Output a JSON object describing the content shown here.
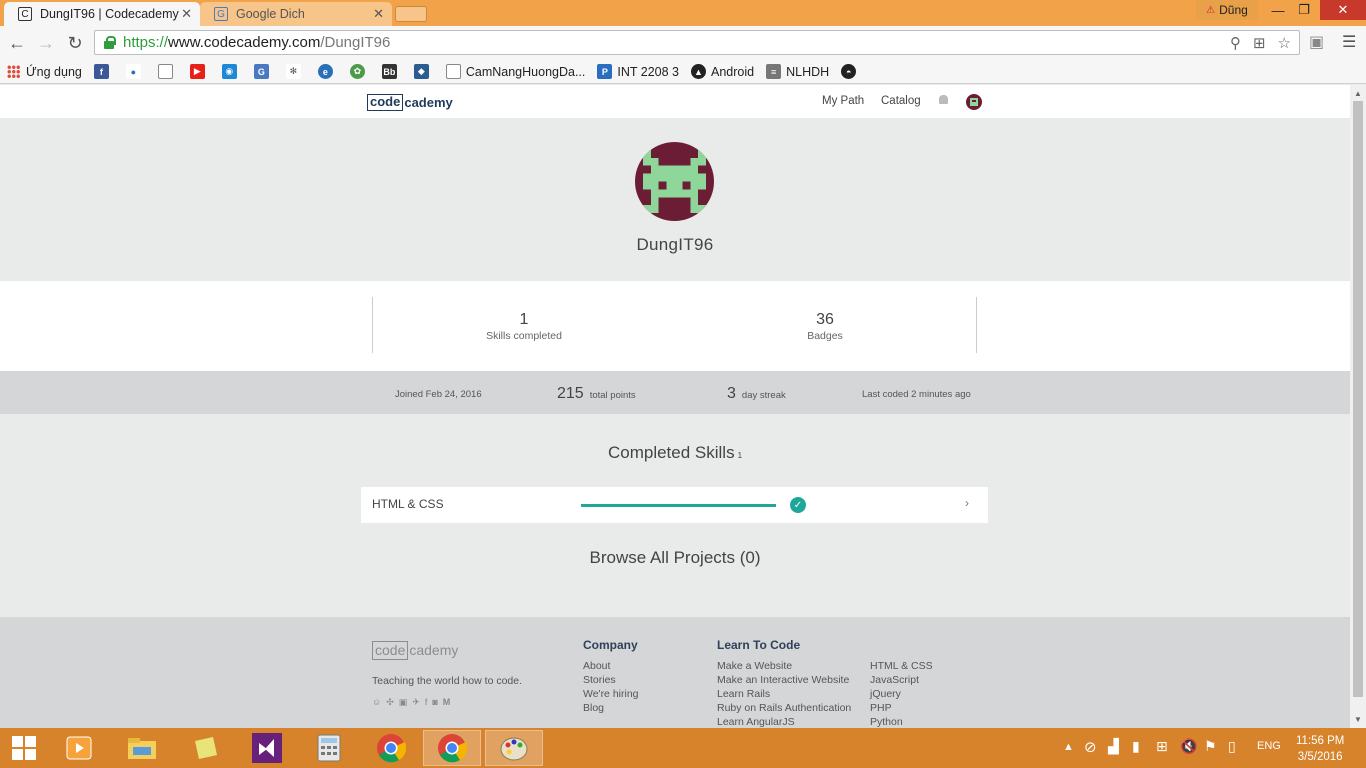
{
  "browser": {
    "tabs": [
      {
        "title": "DungIT96 | Codecademy",
        "active": true
      },
      {
        "title": "Google Dich",
        "active": false
      }
    ],
    "user_badge": "Dũng",
    "url": {
      "scheme": "https://",
      "host": "www.codecademy.com",
      "path": "/DungIT96"
    },
    "bookmarks": [
      {
        "label": "Ứng dụng",
        "icon": "apps-icon"
      },
      {
        "label": "",
        "icon": "facebook-icon",
        "color": "#3b5998"
      },
      {
        "label": "",
        "icon": "blue-dot-icon",
        "color": "#2a6fbf"
      },
      {
        "label": "",
        "icon": "page-icon",
        "color": "#888888"
      },
      {
        "label": "",
        "icon": "youtube-icon",
        "color": "#e62117"
      },
      {
        "label": "",
        "icon": "camera-icon",
        "color": "#1e88d6"
      },
      {
        "label": "",
        "icon": "translate-icon",
        "color": "#4a78c2"
      },
      {
        "label": "",
        "icon": "gear-icon",
        "color": "#555555"
      },
      {
        "label": "",
        "icon": "globe-icon",
        "color": "#2a70b8"
      },
      {
        "label": "",
        "icon": "leaf-icon",
        "color": "#4b9b4b"
      },
      {
        "label": "",
        "icon": "bb-icon",
        "color": "#333333"
      },
      {
        "label": "",
        "icon": "shield-icon",
        "color": "#2b5d8e"
      },
      {
        "label": "CamNangHuongDa...",
        "icon": "page-icon",
        "color": "#888888"
      },
      {
        "label": "INT 2208 3",
        "icon": "p-icon",
        "color": "#2a6fbf"
      },
      {
        "label": "Android",
        "icon": "android-icon",
        "color": "#222222"
      },
      {
        "label": "NLHDH",
        "icon": "doc-icon",
        "color": "#777777"
      },
      {
        "label": "",
        "icon": "github-icon",
        "color": "#222222"
      }
    ]
  },
  "site": {
    "logo_box": "code",
    "logo_rest": "cademy",
    "nav": {
      "my_path": "My Path",
      "catalog": "Catalog"
    }
  },
  "profile": {
    "username": "DungIT96",
    "stats": [
      {
        "value": "1",
        "label": "Skills completed"
      },
      {
        "value": "36",
        "label": "Badges"
      }
    ],
    "info": {
      "joined": "Joined Feb 24, 2016",
      "points_value": "215",
      "points_label": "total points",
      "streak_value": "3",
      "streak_label": "day streak",
      "last_coded": "Last coded 2 minutes ago"
    },
    "completed_skills_title": "Completed Skills",
    "completed_skills_count": "1",
    "skills": [
      {
        "name": "HTML & CSS",
        "progress": 1.0
      }
    ],
    "projects_title": "Browse All Projects (0)"
  },
  "footer": {
    "logo_box": "code",
    "logo_rest": "cademy",
    "tagline": "Teaching the world how to code.",
    "company_head": "Company",
    "company_links": [
      "About",
      "Stories",
      "We're hiring",
      "Blog"
    ],
    "learn_head": "Learn To Code",
    "learn_links_a": [
      "Make a Website",
      "Make an Interactive Website",
      "Learn Rails",
      "Ruby on Rails Authentication",
      "Learn AngularJS"
    ],
    "learn_links_b": [
      "HTML & CSS",
      "JavaScript",
      "jQuery",
      "PHP",
      "Python"
    ],
    "social_icons": [
      "reddit-icon",
      "stumbleupon-icon",
      "youtube-icon",
      "twitter-icon",
      "facebook-icon",
      "instagram-icon",
      "medium-icon"
    ]
  },
  "taskbar": {
    "language": "ENG",
    "time": "11:56 PM",
    "date": "3/5/2016"
  },
  "colors": {
    "accent_teal": "#1fa79a",
    "avatar_bg": "#6b1d35",
    "avatar_fg": "#8fd69a",
    "titlebar": "#f2a34a",
    "taskbar": "#d7832c"
  }
}
